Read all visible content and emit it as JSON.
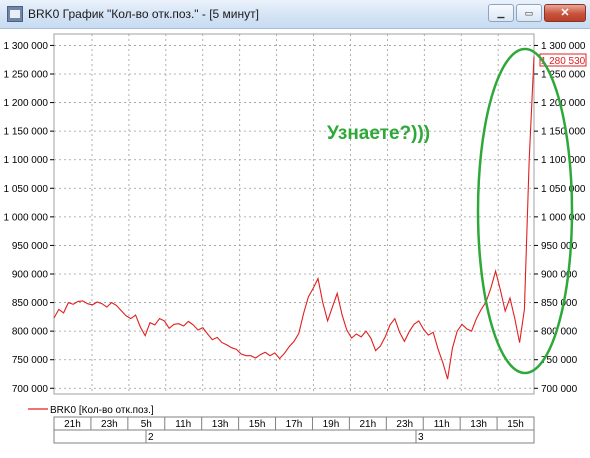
{
  "window": {
    "title": "BRK0 График \"Кол-во отк.поз.\" - [5 минут]",
    "minimize_glyph": "▁",
    "restore_glyph": "▭",
    "close_glyph": "✕"
  },
  "annotation": {
    "text": "Узнаете?)))",
    "color": "#2fa83a"
  },
  "current_value_label": "1 280 530",
  "chart_data": {
    "type": "line",
    "series": [
      {
        "name": "BRK0 [Кол-во отк.поз.]",
        "color": "#e02020",
        "x": [
          0,
          2,
          4,
          6,
          8,
          10,
          12,
          14,
          16,
          18,
          20,
          22,
          24,
          26,
          28,
          30,
          32,
          34,
          36,
          38,
          40,
          42,
          44,
          46,
          48,
          50,
          52,
          54,
          56,
          58,
          60,
          62,
          64,
          66,
          68,
          70,
          72,
          74,
          76,
          78,
          80,
          82,
          84,
          86,
          88,
          90,
          92,
          94,
          96,
          98,
          100,
          102,
          104,
          106,
          108,
          110,
          112,
          114,
          116,
          118,
          120,
          122,
          124,
          126,
          128,
          130,
          132,
          134,
          136,
          138,
          140,
          142,
          144,
          146,
          148,
          150,
          152,
          154,
          156,
          158,
          160,
          162,
          164,
          166,
          168,
          170,
          172,
          174,
          176,
          178,
          180,
          182,
          184,
          186,
          188,
          190,
          192,
          194,
          196,
          198,
          200
        ],
        "values": [
          823000,
          838000,
          832000,
          850000,
          847000,
          852000,
          853000,
          848000,
          846000,
          851000,
          848000,
          842000,
          850000,
          845000,
          836000,
          827000,
          822000,
          828000,
          807000,
          792000,
          815000,
          811000,
          822000,
          818000,
          805000,
          812000,
          813000,
          809000,
          817000,
          811000,
          802000,
          806000,
          795000,
          785000,
          789000,
          780000,
          776000,
          771000,
          768000,
          760000,
          757000,
          757000,
          753000,
          759000,
          763000,
          757000,
          762000,
          752000,
          761000,
          773000,
          782000,
          796000,
          831000,
          860000,
          875000,
          892000,
          850000,
          818000,
          842000,
          866000,
          829000,
          802000,
          788000,
          795000,
          790000,
          800000,
          788000,
          766000,
          774000,
          790000,
          811000,
          822000,
          798000,
          782000,
          799000,
          812000,
          818000,
          803000,
          793000,
          798000,
          769000,
          745000,
          716000,
          770000,
          800000,
          812000,
          804000,
          800000,
          822000,
          838000,
          851000,
          875000,
          905000,
          872000,
          835000,
          858000,
          822000,
          780000,
          838000,
          1100000,
          1280530
        ]
      }
    ],
    "x_tick_labels": [
      "21h",
      "23h",
      "5h",
      "11h",
      "13h",
      "15h",
      "17h",
      "19h",
      "21h",
      "23h",
      "11h",
      "13h",
      "15h"
    ],
    "day_labels": [
      "2",
      "3"
    ],
    "yticks": [
      700000,
      750000,
      800000,
      850000,
      900000,
      950000,
      1000000,
      1050000,
      1100000,
      1150000,
      1200000,
      1250000,
      1300000
    ],
    "ytick_labels": [
      "700 000",
      "750 000",
      "800 000",
      "850 000",
      "900 000",
      "950 000",
      "1 000 000",
      "1 050 000",
      "1 100 000",
      "1 150 000",
      "1 200 000",
      "1 250 000",
      "1 300 000"
    ],
    "ylim": [
      690000,
      1320000
    ],
    "grid": true,
    "legend_position": "bottom-left"
  }
}
